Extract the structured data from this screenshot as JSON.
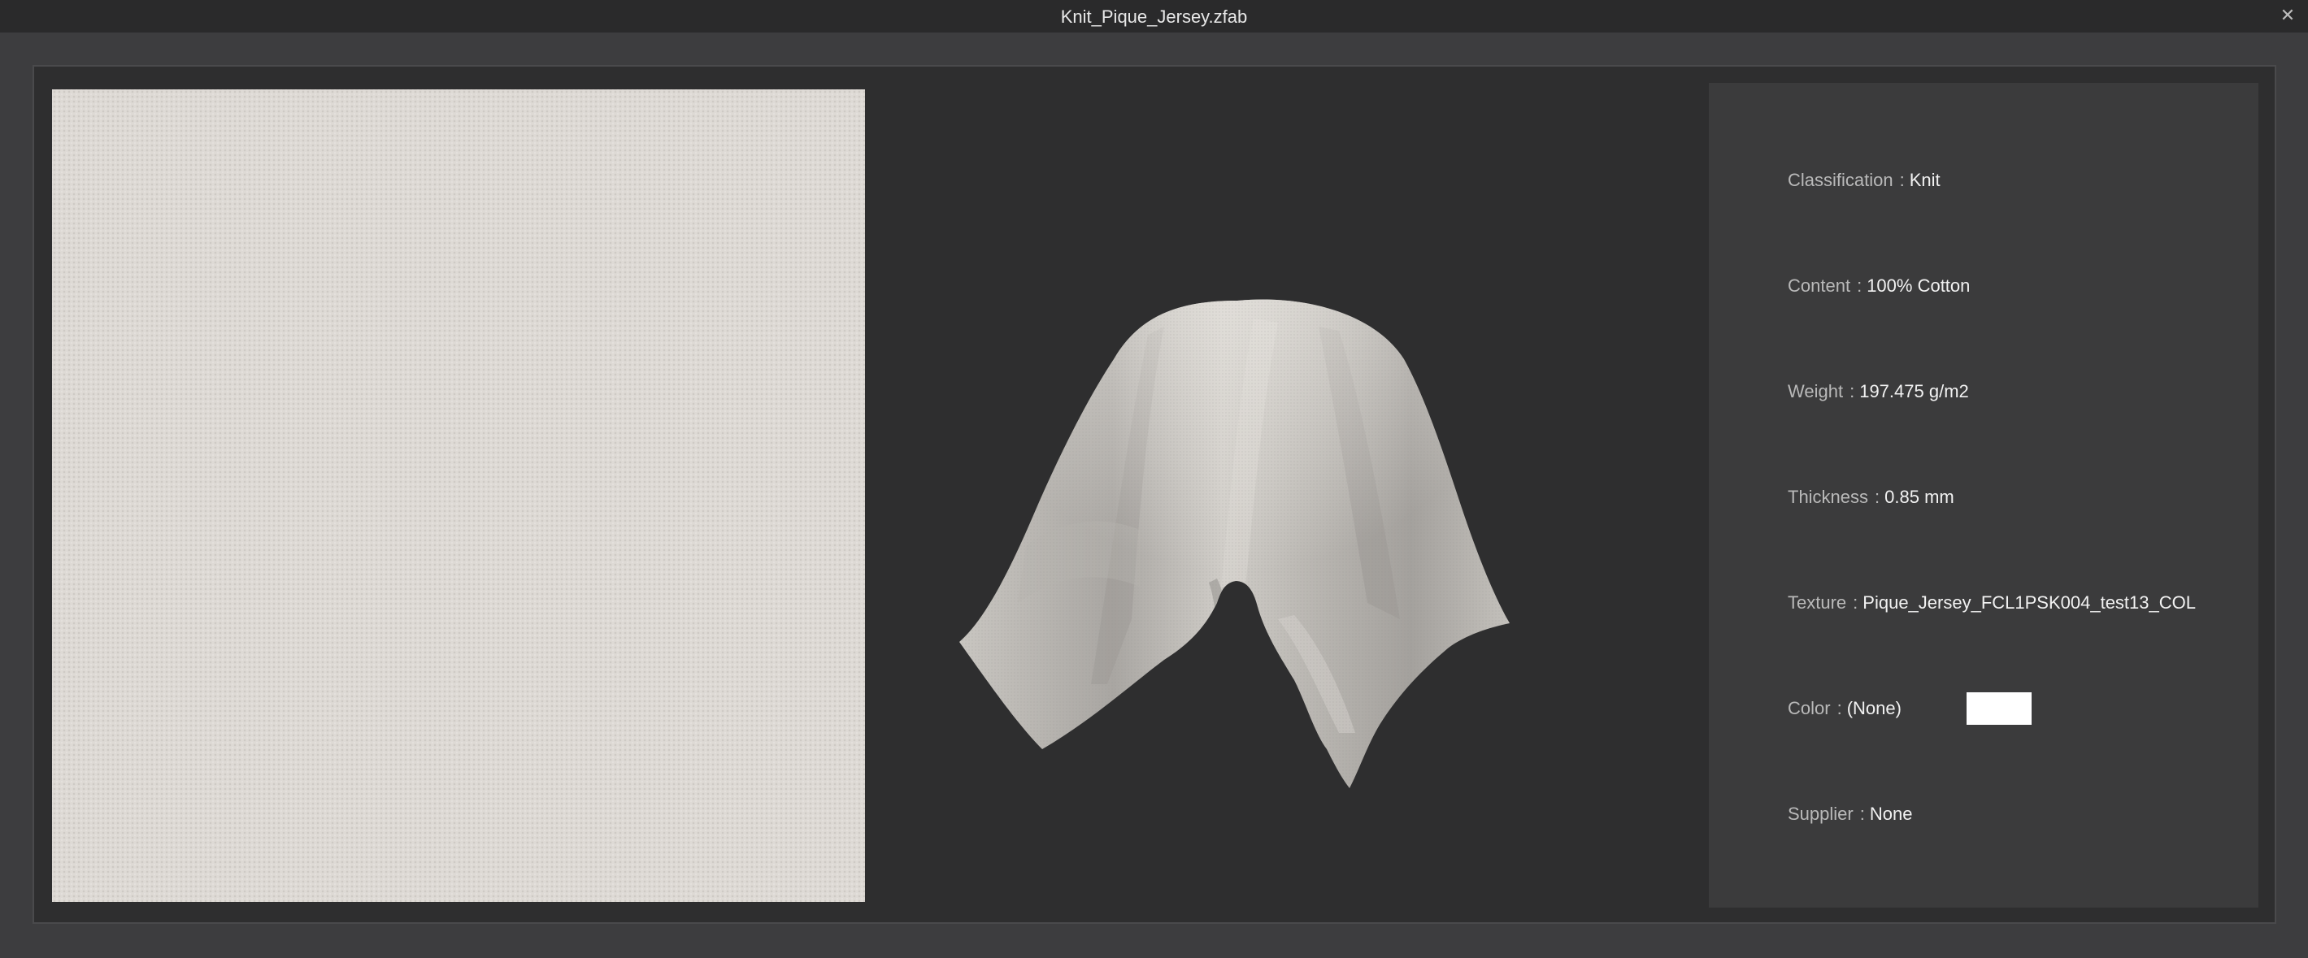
{
  "window": {
    "title": "Knit_Pique_Jersey.zfab",
    "close_glyph": "✕"
  },
  "colors": {
    "background": "#3d3d3f",
    "titlebar": "#2a2a2b",
    "viewport": "#2e2e2f",
    "info_panel": "#3b3b3c",
    "fabric": "#dedad5",
    "color_chip": "#ffffff"
  },
  "icons": {
    "close": "close-icon"
  },
  "info": {
    "separator": ":",
    "classification": {
      "label": "Classification",
      "value": "Knit"
    },
    "content": {
      "label": "Content",
      "value": "100% Cotton"
    },
    "weight": {
      "label": "Weight",
      "value": "197.475 g/m2"
    },
    "thickness": {
      "label": "Thickness",
      "value": "0.85 mm"
    },
    "texture": {
      "label": "Texture",
      "value": "Pique_Jersey_FCL1PSK004_test13_COL"
    },
    "color": {
      "label": "Color",
      "value": "(None)"
    },
    "supplier": {
      "label": "Supplier",
      "value": "None"
    }
  }
}
